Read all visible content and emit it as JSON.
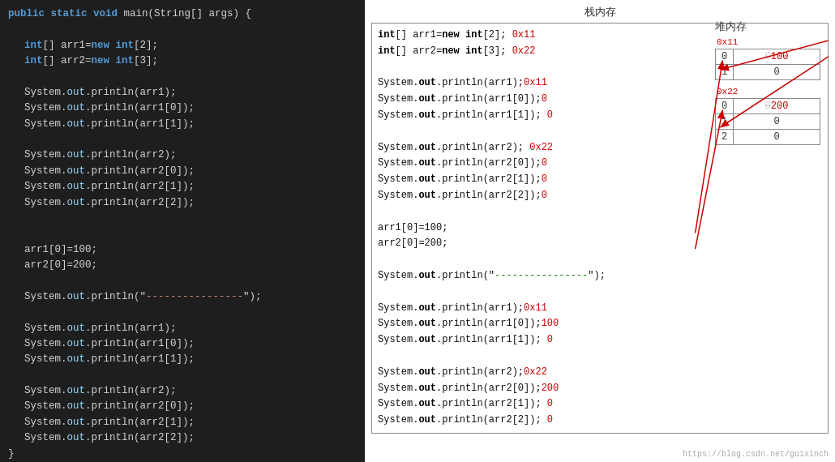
{
  "left": {
    "lines": [
      {
        "indent": 0,
        "parts": [
          {
            "t": "public ",
            "c": "kw"
          },
          {
            "t": "static ",
            "c": "kw"
          },
          {
            "t": "void ",
            "c": "kw"
          },
          {
            "t": "main(String[] args) {",
            "c": "plain"
          }
        ]
      },
      {
        "indent": 1,
        "parts": []
      },
      {
        "indent": 1,
        "parts": [
          {
            "t": "int",
            "c": "kw"
          },
          {
            "t": "[] arr1=",
            "c": "plain"
          },
          {
            "t": "new ",
            "c": "kw"
          },
          {
            "t": "int",
            "c": "kw"
          },
          {
            "t": "[2];",
            "c": "plain"
          }
        ]
      },
      {
        "indent": 1,
        "parts": [
          {
            "t": "int",
            "c": "kw"
          },
          {
            "t": "[] arr2=",
            "c": "plain"
          },
          {
            "t": "new ",
            "c": "kw"
          },
          {
            "t": "int",
            "c": "kw"
          },
          {
            "t": "[3];",
            "c": "plain"
          }
        ]
      },
      {
        "indent": 1,
        "parts": []
      },
      {
        "indent": 1,
        "parts": [
          {
            "t": "System.",
            "c": "plain"
          },
          {
            "t": "out",
            "c": "var"
          },
          {
            "t": ".println(arr1);",
            "c": "plain"
          }
        ]
      },
      {
        "indent": 1,
        "parts": [
          {
            "t": "System.",
            "c": "plain"
          },
          {
            "t": "out",
            "c": "var"
          },
          {
            "t": ".println(arr1[0]);",
            "c": "plain"
          }
        ]
      },
      {
        "indent": 1,
        "parts": [
          {
            "t": "System.",
            "c": "plain"
          },
          {
            "t": "out",
            "c": "var"
          },
          {
            "t": ".println(arr1[1]);",
            "c": "plain"
          }
        ]
      },
      {
        "indent": 1,
        "parts": []
      },
      {
        "indent": 1,
        "parts": [
          {
            "t": "System.",
            "c": "plain"
          },
          {
            "t": "out",
            "c": "var"
          },
          {
            "t": ".println(arr2);",
            "c": "plain"
          }
        ]
      },
      {
        "indent": 1,
        "parts": [
          {
            "t": "System.",
            "c": "plain"
          },
          {
            "t": "out",
            "c": "var"
          },
          {
            "t": ".println(arr2[0]);",
            "c": "plain"
          }
        ]
      },
      {
        "indent": 1,
        "parts": [
          {
            "t": "System.",
            "c": "plain"
          },
          {
            "t": "out",
            "c": "var"
          },
          {
            "t": ".println(arr2[1]);",
            "c": "plain"
          }
        ]
      },
      {
        "indent": 1,
        "parts": [
          {
            "t": "System.",
            "c": "plain"
          },
          {
            "t": "out",
            "c": "var"
          },
          {
            "t": ".println(arr2[2]);",
            "c": "plain"
          }
        ]
      },
      {
        "indent": 1,
        "parts": []
      },
      {
        "indent": 1,
        "parts": []
      },
      {
        "indent": 1,
        "parts": [
          {
            "t": "arr1[0]=100;",
            "c": "plain"
          }
        ]
      },
      {
        "indent": 1,
        "parts": [
          {
            "t": "arr2[0]=200;",
            "c": "plain"
          }
        ]
      },
      {
        "indent": 1,
        "parts": []
      },
      {
        "indent": 1,
        "parts": [
          {
            "t": "System.",
            "c": "plain"
          },
          {
            "t": "out",
            "c": "var"
          },
          {
            "t": ".println(\"",
            "c": "plain"
          },
          {
            "t": "----------------",
            "c": "str"
          },
          {
            "t": "\");",
            "c": "plain"
          }
        ]
      },
      {
        "indent": 1,
        "parts": []
      },
      {
        "indent": 1,
        "parts": [
          {
            "t": "System.",
            "c": "plain"
          },
          {
            "t": "out",
            "c": "var"
          },
          {
            "t": ".println(arr1);",
            "c": "plain"
          }
        ]
      },
      {
        "indent": 1,
        "parts": [
          {
            "t": "System.",
            "c": "plain"
          },
          {
            "t": "out",
            "c": "var"
          },
          {
            "t": ".println(arr1[0]);",
            "c": "plain"
          }
        ]
      },
      {
        "indent": 1,
        "parts": [
          {
            "t": "System.",
            "c": "plain"
          },
          {
            "t": "out",
            "c": "var"
          },
          {
            "t": ".println(arr1[1]);",
            "c": "plain"
          }
        ]
      },
      {
        "indent": 1,
        "parts": []
      },
      {
        "indent": 1,
        "parts": [
          {
            "t": "System.",
            "c": "plain"
          },
          {
            "t": "out",
            "c": "var"
          },
          {
            "t": ".println(arr2);",
            "c": "plain"
          }
        ]
      },
      {
        "indent": 1,
        "parts": [
          {
            "t": "System.",
            "c": "plain"
          },
          {
            "t": "out",
            "c": "var"
          },
          {
            "t": ".println(arr2[0]);",
            "c": "plain"
          }
        ]
      },
      {
        "indent": 1,
        "parts": [
          {
            "t": "System.",
            "c": "plain"
          },
          {
            "t": "out",
            "c": "var"
          },
          {
            "t": ".println(arr2[1]);",
            "c": "plain"
          }
        ]
      },
      {
        "indent": 1,
        "parts": [
          {
            "t": "System.",
            "c": "plain"
          },
          {
            "t": "out",
            "c": "var"
          },
          {
            "t": ".println(arr2[2]);",
            "c": "plain"
          }
        ]
      },
      {
        "indent": 0,
        "parts": [
          {
            "t": "}",
            "c": "plain"
          }
        ]
      }
    ]
  },
  "stack": {
    "title": "栈内存",
    "lines": [
      {
        "parts": [
          {
            "t": "int",
            "c": "bold"
          },
          {
            "t": "[] arr1=",
            "c": "plain"
          },
          {
            "t": "new ",
            "c": "bold"
          },
          {
            "t": "int",
            "c": "bold"
          },
          {
            "t": "[2];",
            "c": "plain"
          },
          {
            "t": "  0x11",
            "c": "red"
          }
        ]
      },
      {
        "parts": [
          {
            "t": "int",
            "c": "bold"
          },
          {
            "t": "[] arr2=",
            "c": "plain"
          },
          {
            "t": "new ",
            "c": "bold"
          },
          {
            "t": "int",
            "c": "bold"
          },
          {
            "t": "[3];",
            "c": "plain"
          },
          {
            "t": "  0x22",
            "c": "red"
          }
        ]
      },
      {
        "parts": []
      },
      {
        "parts": [
          {
            "t": "System.",
            "c": "plain"
          },
          {
            "t": "out",
            "c": "bold"
          },
          {
            "t": ".println(arr1);",
            "c": "plain"
          },
          {
            "t": "0x11",
            "c": "red"
          }
        ]
      },
      {
        "parts": [
          {
            "t": "System.",
            "c": "plain"
          },
          {
            "t": "out",
            "c": "bold"
          },
          {
            "t": ".println(arr1[0]);",
            "c": "plain"
          },
          {
            "t": "0",
            "c": "red"
          }
        ]
      },
      {
        "parts": [
          {
            "t": "System.",
            "c": "plain"
          },
          {
            "t": "out",
            "c": "bold"
          },
          {
            "t": ".println(arr1[1]);",
            "c": "plain"
          },
          {
            "t": " 0",
            "c": "red"
          }
        ]
      },
      {
        "parts": []
      },
      {
        "parts": [
          {
            "t": "System.",
            "c": "plain"
          },
          {
            "t": "out",
            "c": "bold"
          },
          {
            "t": ".println(arr2);",
            "c": "plain"
          },
          {
            "t": " 0x22",
            "c": "red"
          }
        ]
      },
      {
        "parts": [
          {
            "t": "System.",
            "c": "plain"
          },
          {
            "t": "out",
            "c": "bold"
          },
          {
            "t": ".println(arr2[0]);",
            "c": "plain"
          },
          {
            "t": "0",
            "c": "red"
          }
        ]
      },
      {
        "parts": [
          {
            "t": "System.",
            "c": "plain"
          },
          {
            "t": "out",
            "c": "bold"
          },
          {
            "t": ".println(arr2[1]);",
            "c": "plain"
          },
          {
            "t": "0",
            "c": "red"
          }
        ]
      },
      {
        "parts": [
          {
            "t": "System.",
            "c": "plain"
          },
          {
            "t": "out",
            "c": "bold"
          },
          {
            "t": ".println(arr2[2]);",
            "c": "plain"
          },
          {
            "t": "0",
            "c": "red"
          }
        ]
      },
      {
        "parts": []
      },
      {
        "parts": [
          {
            "t": "arr1[0]=100;",
            "c": "plain"
          }
        ]
      },
      {
        "parts": [
          {
            "t": "arr2[0]=200;",
            "c": "plain"
          }
        ]
      },
      {
        "parts": []
      },
      {
        "parts": [
          {
            "t": "System.",
            "c": "plain"
          },
          {
            "t": "out",
            "c": "bold"
          },
          {
            "t": ".println(\"",
            "c": "plain"
          },
          {
            "t": "----------------",
            "c": "green"
          },
          {
            "t": "\");",
            "c": "plain"
          }
        ]
      },
      {
        "parts": []
      },
      {
        "parts": [
          {
            "t": "System.",
            "c": "plain"
          },
          {
            "t": "out",
            "c": "bold"
          },
          {
            "t": ".println(arr1);",
            "c": "plain"
          },
          {
            "t": "0x11",
            "c": "red"
          }
        ]
      },
      {
        "parts": [
          {
            "t": "System.",
            "c": "plain"
          },
          {
            "t": "out",
            "c": "bold"
          },
          {
            "t": ".println(arr1[0]);",
            "c": "plain"
          },
          {
            "t": "100",
            "c": "red"
          }
        ]
      },
      {
        "parts": [
          {
            "t": "System.",
            "c": "plain"
          },
          {
            "t": "out",
            "c": "bold"
          },
          {
            "t": ".println(arr1[1]);",
            "c": "plain"
          },
          {
            "t": " 0",
            "c": "red"
          }
        ]
      },
      {
        "parts": []
      },
      {
        "parts": [
          {
            "t": "System.",
            "c": "plain"
          },
          {
            "t": "out",
            "c": "bold"
          },
          {
            "t": ".println(arr2);",
            "c": "plain"
          },
          {
            "t": "0x22",
            "c": "red"
          }
        ]
      },
      {
        "parts": [
          {
            "t": "System.",
            "c": "plain"
          },
          {
            "t": "out",
            "c": "bold"
          },
          {
            "t": ".println(arr2[0]);",
            "c": "plain"
          },
          {
            "t": "200",
            "c": "red"
          }
        ]
      },
      {
        "parts": [
          {
            "t": "System.",
            "c": "plain"
          },
          {
            "t": "out",
            "c": "bold"
          },
          {
            "t": ".println(arr2[1]);",
            "c": "plain"
          },
          {
            "t": " 0",
            "c": "red"
          }
        ]
      },
      {
        "parts": [
          {
            "t": "System.",
            "c": "plain"
          },
          {
            "t": "out",
            "c": "bold"
          },
          {
            "t": ".println(arr2[2]);",
            "c": "plain"
          },
          {
            "t": " 0",
            "c": "red"
          }
        ]
      }
    ]
  },
  "heap": {
    "title": "堆内存",
    "arr1": {
      "addr": "0x11",
      "rows": [
        {
          "idx": "0",
          "val": "0",
          "val_color": "red",
          "extra": "100"
        },
        {
          "idx": "1",
          "val": "0",
          "val_color": "normal"
        }
      ]
    },
    "arr2": {
      "addr": "0x22",
      "rows": [
        {
          "idx": "0",
          "val": "0",
          "val_color": "red",
          "extra": "200"
        },
        {
          "idx": "1",
          "val": "0",
          "val_color": "normal"
        },
        {
          "idx": "2",
          "val": "0",
          "val_color": "normal"
        }
      ]
    }
  },
  "watermark": "https://blog.csdn.net/guixinch"
}
